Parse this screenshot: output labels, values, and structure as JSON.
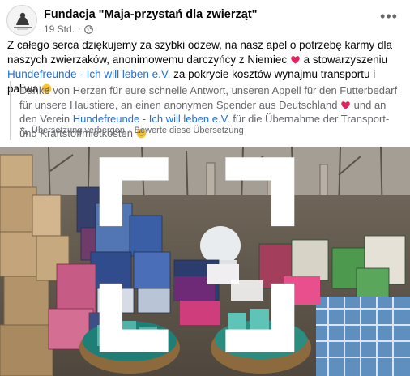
{
  "header": {
    "page_name": "Fundacja \"Maja-przystań dla zwierząt\"",
    "timestamp": "19 Std.",
    "separator": "·"
  },
  "post": {
    "text_before_link": "Z całego serca dziękujemy za szybki odzew, na nasz apel o potrzebę karmy dla naszych zwierzaków,  anonimowemu darczyńcy z Niemiec ",
    "text_mid": " a stowarzyszeniu ",
    "link_text": "Hundefreunde - Ich will leben e.V.",
    "text_after_link": " za pokrycie kosztów wynajmu transportu i paliwa "
  },
  "translation": {
    "text_before_heart": "Danke von Herzen für eure schnelle Antwort, unseren Appell für den Futterbedarf für unsere Haustiere, an einen anonymen Spender aus Deutschland ",
    "text_mid": " und an den Verein ",
    "link_text": "Hundefreunde - Ich will leben e.V.",
    "text_after_link": " für die Übernahme der Transport- und Kraftstoffmietkosten ",
    "hide_label": "Übersetzung verbergen",
    "separator": "·",
    "rate_label": "Bewerte diese Übersetzung"
  },
  "icons": {
    "globe": "globe-icon",
    "more": "more-options-icon",
    "heart": "red-heart-emoji",
    "smile": "smiling-face-emoji",
    "translate": "translate-icon",
    "expand": "expand-icon"
  },
  "colors": {
    "link": "#216fdb",
    "secondary_text": "#65676b",
    "heart": "#e0245e"
  }
}
